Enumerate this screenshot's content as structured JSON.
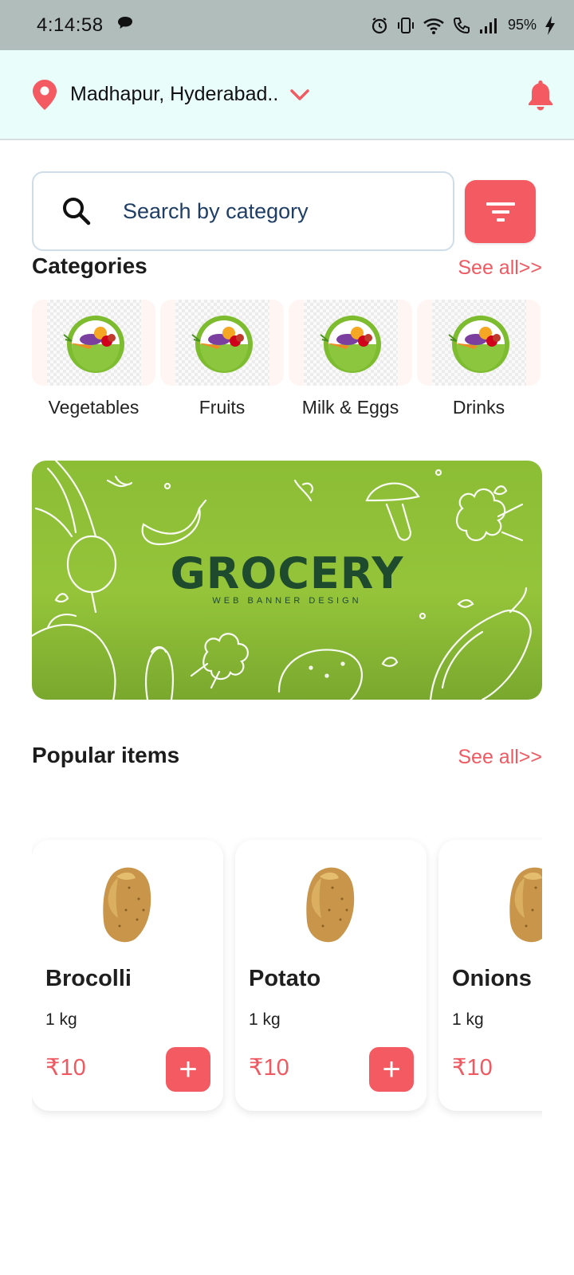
{
  "status_bar": {
    "time": "4:14:58",
    "battery": "95%"
  },
  "header": {
    "location": "Madhapur, Hyderabad..",
    "accent_color": "#f45a62"
  },
  "search": {
    "placeholder": "Search by category"
  },
  "categories": {
    "title": "Categories",
    "see_all": "See all>>",
    "items": [
      {
        "label": "Vegetables",
        "icon": "vegetable-basket-icon"
      },
      {
        "label": "Fruits",
        "icon": "vegetable-basket-icon"
      },
      {
        "label": "Milk & Eggs",
        "icon": "vegetable-basket-icon"
      },
      {
        "label": "Drinks",
        "icon": "vegetable-basket-icon"
      }
    ]
  },
  "banner": {
    "title": "GROCERY",
    "subtitle": "WEB BANNER DESIGN"
  },
  "popular": {
    "title": "Popular items",
    "see_all": "See all>>",
    "items": [
      {
        "name": "Brocolli",
        "qty": "1 kg",
        "price": "₹10",
        "add": "+",
        "icon": "potato-icon"
      },
      {
        "name": "Potato",
        "qty": "1 kg",
        "price": "₹10",
        "add": "+",
        "icon": "potato-icon"
      },
      {
        "name": "Onions",
        "qty": "1 kg",
        "price": "₹10",
        "add": "+",
        "icon": "potato-icon"
      }
    ]
  }
}
